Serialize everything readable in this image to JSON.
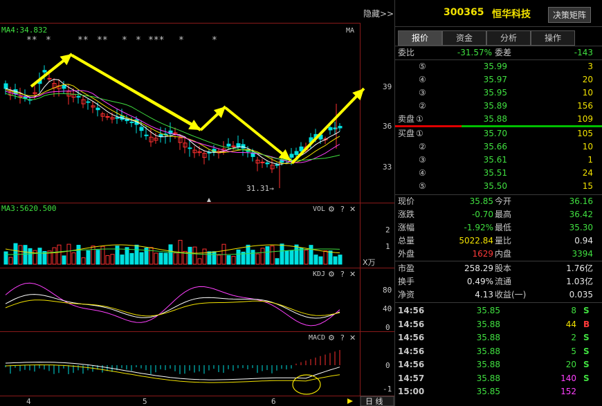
{
  "chart": {
    "ma_label": "MA4:34.832",
    "ma_tag": "MA",
    "hide_label": "隐藏>>",
    "stars": [
      "**",
      "*",
      "**",
      "**",
      "*",
      "*",
      "***",
      "*",
      "*"
    ],
    "price_ticks": [
      "39",
      "36",
      "33"
    ],
    "low_label": "31.31→",
    "vol_ma_label": "MA3:5620.500",
    "vol_tag": "VOL",
    "vol_ticks": [
      "2",
      "1"
    ],
    "vol_unit": "X万",
    "kdj_tag": "KDJ",
    "kdj_ticks": [
      "80",
      "40",
      "0"
    ],
    "macd_tag": "MACD",
    "macd_ticks": [
      "0",
      "-1"
    ],
    "x_labels": [
      "4",
      "5",
      "6"
    ],
    "period_label": "日 线",
    "gear": "⚙",
    "question": "?",
    "close": "✕",
    "icon_colors": {
      "up": "#ff3030",
      "down": "#00e0e0",
      "ma1": "#ffffff",
      "ma2": "#f2e200",
      "ma3": "#ff40ff",
      "ma4": "#40e040",
      "arrow": "#ffff00"
    }
  },
  "quote": {
    "code": "300365",
    "name": "恒华科技",
    "decision_button": "决策矩阵",
    "tabs": [
      "报价",
      "资金",
      "分析",
      "操作"
    ],
    "weibi_label": "委比",
    "weibi_value": "-31.57%",
    "weicha_label": "委差",
    "weicha_value": "-143",
    "sell_label": "卖盘",
    "buy_label": "买盘",
    "sells": [
      {
        "num": "⑤",
        "price": "35.99",
        "vol": "3"
      },
      {
        "num": "④",
        "price": "35.97",
        "vol": "20"
      },
      {
        "num": "③",
        "price": "35.95",
        "vol": "10"
      },
      {
        "num": "②",
        "price": "35.89",
        "vol": "156"
      },
      {
        "num": "①",
        "price": "35.88",
        "vol": "109"
      }
    ],
    "buys": [
      {
        "num": "①",
        "price": "35.70",
        "vol": "105"
      },
      {
        "num": "②",
        "price": "35.66",
        "vol": "10"
      },
      {
        "num": "③",
        "price": "35.61",
        "vol": "1"
      },
      {
        "num": "④",
        "price": "35.51",
        "vol": "24"
      },
      {
        "num": "⑤",
        "price": "35.50",
        "vol": "15"
      }
    ],
    "stats": [
      {
        "l1": "现价",
        "v1": "35.85",
        "c1": "green",
        "l2": "今开",
        "v2": "36.16",
        "c2": "green"
      },
      {
        "l1": "涨跌",
        "v1": "-0.70",
        "c1": "green",
        "l2": "最高",
        "v2": "36.42",
        "c2": "green"
      },
      {
        "l1": "涨幅",
        "v1": "-1.92%",
        "c1": "green",
        "l2": "最低",
        "v2": "35.30",
        "c2": "green"
      },
      {
        "l1": "总量",
        "v1": "5022.84",
        "c1": "yellow",
        "l2": "量比",
        "v2": "0.94",
        "c2": "white"
      },
      {
        "l1": "外盘",
        "v1": "1629",
        "c1": "red",
        "l2": "内盘",
        "v2": "3394",
        "c2": "green"
      },
      {
        "l1": "市盈",
        "v1": "258.29",
        "c1": "white",
        "l2": "股本",
        "v2": "1.76亿",
        "c2": "white"
      },
      {
        "l1": "换手",
        "v1": "0.49%",
        "c1": "white",
        "l2": "流通",
        "v2": "1.03亿",
        "c2": "white"
      },
      {
        "l1": "净资",
        "v1": "4.13",
        "c1": "white",
        "l2": "收益(一)",
        "v2": "0.035",
        "c2": "white"
      }
    ],
    "ticks": [
      {
        "time": "14:56",
        "price": "35.85",
        "vol": "8",
        "vc": "green",
        "side": "S",
        "sc": "green"
      },
      {
        "time": "14:56",
        "price": "35.88",
        "vol": "44",
        "vc": "yellow",
        "side": "B",
        "sc": "red"
      },
      {
        "time": "14:56",
        "price": "35.88",
        "vol": "2",
        "vc": "green",
        "side": "S",
        "sc": "green"
      },
      {
        "time": "14:56",
        "price": "35.88",
        "vol": "5",
        "vc": "green",
        "side": "S",
        "sc": "green"
      },
      {
        "time": "14:56",
        "price": "35.88",
        "vol": "20",
        "vc": "green",
        "side": "S",
        "sc": "green"
      },
      {
        "time": "14:57",
        "price": "35.88",
        "vol": "140",
        "vc": "magenta",
        "side": "S",
        "sc": "green"
      },
      {
        "time": "15:00",
        "price": "35.85",
        "vol": "152",
        "vc": "magenta",
        "side": "",
        "sc": "green"
      }
    ]
  }
}
